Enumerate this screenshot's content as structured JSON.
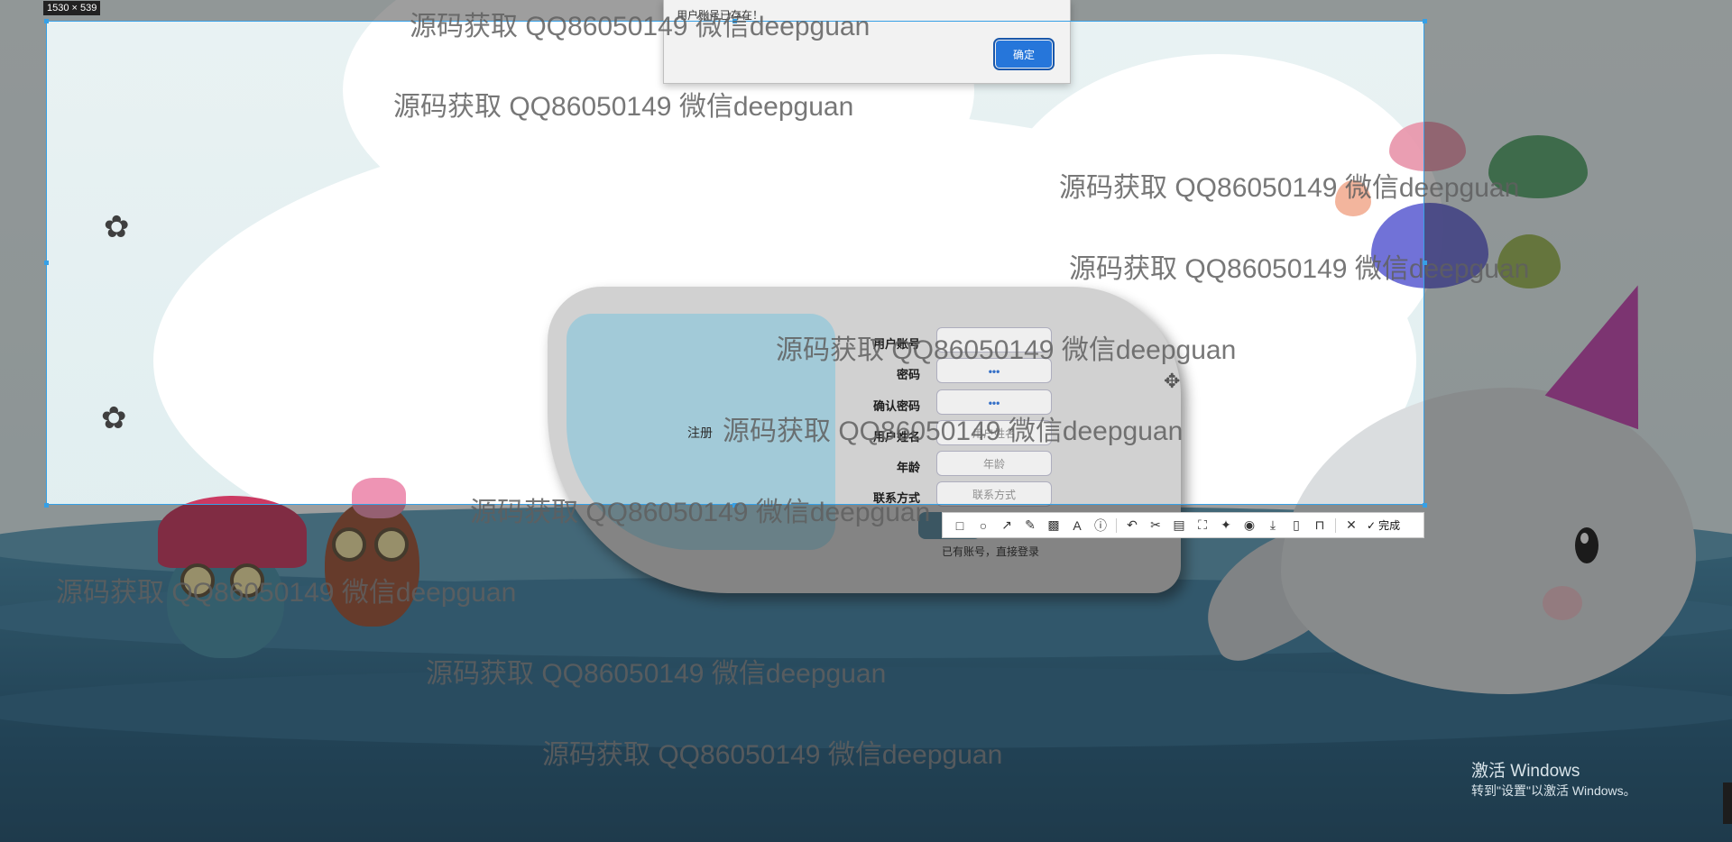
{
  "capture": {
    "size_label": "1530 × 539"
  },
  "alert": {
    "text": "用户账号已存在！",
    "ok_label": "确定"
  },
  "register": {
    "title": "注册",
    "fields": [
      {
        "label": "用户账号",
        "value": ""
      },
      {
        "label": "密码",
        "value": "•••"
      },
      {
        "label": "确认密码",
        "value": "•••"
      },
      {
        "label": "用户姓名",
        "placeholder": "用户姓名"
      },
      {
        "label": "年龄",
        "placeholder": "年龄"
      },
      {
        "label": "联系方式",
        "placeholder": "联系方式"
      }
    ],
    "login_link": "已有账号，直接登录"
  },
  "toolbar": {
    "tools": [
      {
        "icon": "rectangle-icon",
        "glyph": "□"
      },
      {
        "icon": "circle-icon",
        "glyph": "○"
      },
      {
        "icon": "arrow-icon",
        "glyph": "↗"
      },
      {
        "icon": "pencil-icon",
        "glyph": "✎"
      },
      {
        "icon": "mosaic-icon",
        "glyph": "▩"
      },
      {
        "icon": "text-icon",
        "glyph": "A"
      },
      {
        "icon": "number-marker-icon",
        "glyph": "ⓘ"
      },
      {
        "icon": "undo-icon",
        "glyph": "↶"
      },
      {
        "icon": "scissors-icon",
        "glyph": "✂"
      },
      {
        "icon": "ocr-icon",
        "glyph": "▤"
      },
      {
        "icon": "scan-icon",
        "glyph": "⛶"
      },
      {
        "icon": "pin-icon",
        "glyph": "✦"
      },
      {
        "icon": "record-icon",
        "glyph": "◉"
      },
      {
        "icon": "download-icon",
        "glyph": "⤓"
      },
      {
        "icon": "phone-icon",
        "glyph": "▯"
      },
      {
        "icon": "bookmark-icon",
        "glyph": "⊓"
      },
      {
        "icon": "close-icon",
        "glyph": "✕"
      }
    ],
    "done_label": "完成"
  },
  "watermark": "源码获取 QQ86050149 微信deepguan",
  "windows_activation": {
    "title": "激活 Windows",
    "subtitle": "转到\"设置\"以激活 Windows。"
  },
  "colors": {
    "selection": "#36a0e6",
    "ok_button": "#1b6fd9"
  }
}
